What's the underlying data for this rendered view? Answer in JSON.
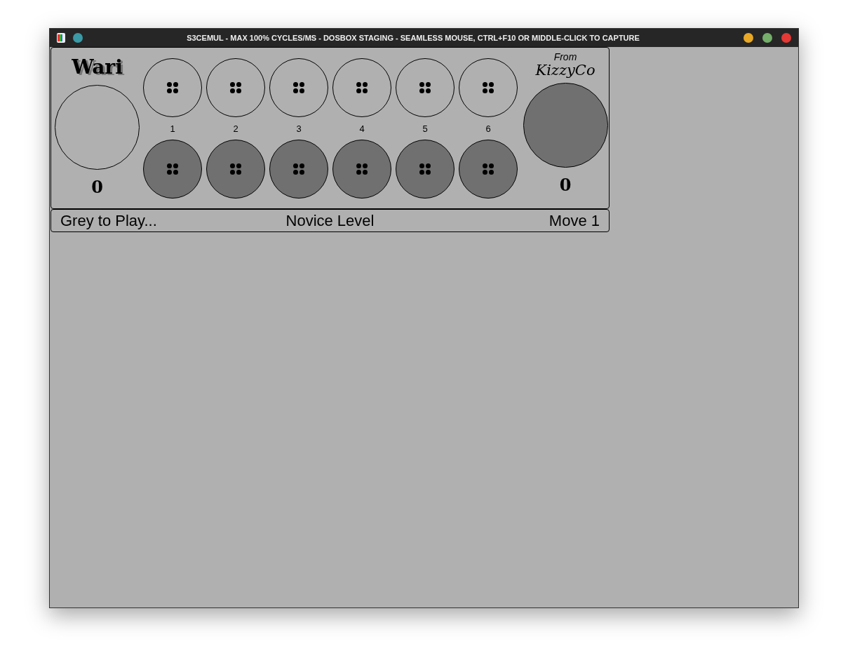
{
  "window": {
    "title": "S3CEMUL - MAX 100% CYCLES/MS - DOSBOX STAGING - SEAMLESS MOUSE, CTRL+F10 OR MIDDLE-CLICK TO CAPTURE"
  },
  "game_title": "Wari",
  "credit": {
    "from": "From",
    "brand": "KizzyCo"
  },
  "stores": [
    {
      "kind": "light",
      "score": "0"
    },
    {
      "kind": "dark",
      "score": "0"
    }
  ],
  "pit_numbers": [
    "1",
    "2",
    "3",
    "4",
    "5",
    "6"
  ],
  "rows": [
    {
      "kind": "light",
      "pits": [
        {
          "kind": "seeds"
        },
        {
          "kind": "seeds"
        },
        {
          "kind": "seeds"
        },
        {
          "kind": "seeds"
        },
        {
          "kind": "seeds"
        },
        {
          "kind": "seeds"
        }
      ]
    },
    {
      "kind": "dark",
      "pits": [
        {
          "kind": "seeds"
        },
        {
          "kind": "seeds"
        },
        {
          "kind": "seeds"
        },
        {
          "kind": "seeds"
        },
        {
          "kind": "seeds"
        },
        {
          "kind": "seeds"
        }
      ]
    }
  ],
  "status_bar": {
    "turn": "Grey to Play...",
    "level": "Novice Level",
    "move": "Move 1"
  }
}
